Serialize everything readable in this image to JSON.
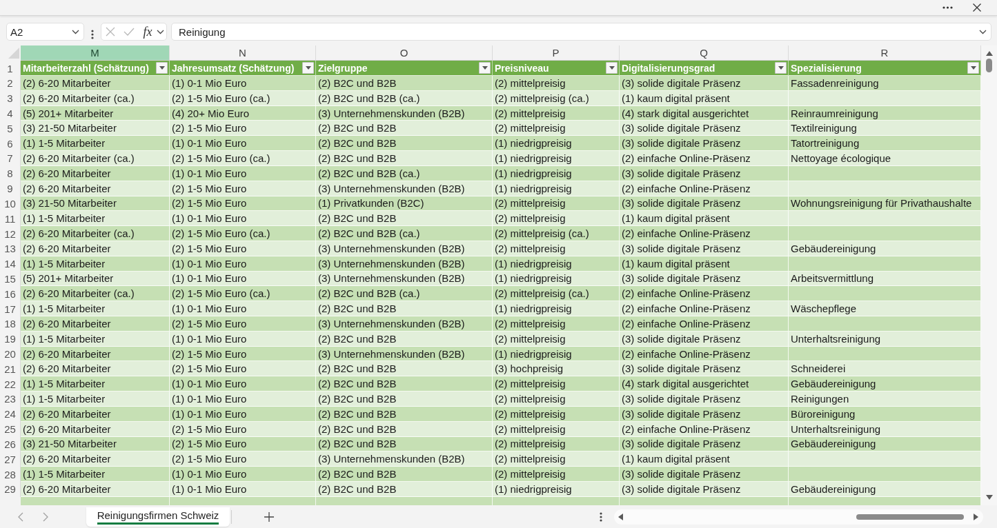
{
  "formula_bar": {
    "name_box": "A2",
    "function_button": "fx",
    "formula": "Reinigung"
  },
  "columns": [
    {
      "letter": "M",
      "selected": true
    },
    {
      "letter": "N",
      "selected": false
    },
    {
      "letter": "O",
      "selected": false
    },
    {
      "letter": "P",
      "selected": false
    },
    {
      "letter": "Q",
      "selected": false
    },
    {
      "letter": "R",
      "selected": false
    }
  ],
  "header_row": {
    "number": "1",
    "cells": [
      "Mitarbeiterzahl (Schätzung)",
      "Jahresumsatz (Schätzung)",
      "Zielgruppe",
      "Preisniveau",
      "Digitalisierungsgrad",
      "Spezialisierung"
    ]
  },
  "rows": [
    {
      "number": "2",
      "cells": [
        "(2) 6-20 Mitarbeiter",
        "(1) 0-1 Mio Euro",
        "(2) B2C und B2B",
        "(2) mittelpreisig",
        "(3) solide digitale Präsenz",
        "Fassadenreinigung"
      ]
    },
    {
      "number": "3",
      "cells": [
        "(2) 6-20 Mitarbeiter (ca.)",
        "(2) 1-5 Mio Euro (ca.)",
        "(2) B2C und B2B (ca.)",
        "(2) mittelpreisig (ca.)",
        "(1) kaum digital präsent"
      ]
    },
    {
      "number": "4",
      "cells": [
        "(5) 201+ Mitarbeiter",
        "(4) 20+ Mio Euro",
        "(3) Unternehmenskunden (B2B)",
        "(2) mittelpreisig",
        "(4) stark digital ausgerichtet",
        "Reinraumreinigung"
      ]
    },
    {
      "number": "5",
      "cells": [
        "(3) 21-50 Mitarbeiter",
        "(2) 1-5 Mio Euro",
        "(2) B2C und B2B",
        "(2) mittelpreisig",
        "(3) solide digitale Präsenz",
        "Textilreinigung"
      ]
    },
    {
      "number": "6",
      "cells": [
        "(1) 1-5 Mitarbeiter",
        "(1) 0-1 Mio Euro",
        "(2) B2C und B2B",
        "(1) niedrigpreisig",
        "(3) solide digitale Präsenz",
        "Tatortreinigung"
      ]
    },
    {
      "number": "7",
      "cells": [
        "(2) 6-20 Mitarbeiter (ca.)",
        "(2) 1-5 Mio Euro (ca.)",
        "(2) B2C und B2B",
        "(1) niedrigpreisig",
        "(2) einfache Online-Präsenz",
        "Nettoyage écologique"
      ]
    },
    {
      "number": "8",
      "cells": [
        "(2) 6-20 Mitarbeiter",
        "(1) 0-1 Mio Euro",
        "(2) B2C und B2B (ca.)",
        "(1) niedrigpreisig",
        "(3) solide digitale Präsenz"
      ]
    },
    {
      "number": "9",
      "cells": [
        "(2) 6-20 Mitarbeiter",
        "(2) 1-5 Mio Euro",
        "(3) Unternehmenskunden (B2B)",
        "(1) niedrigpreisig",
        "(2) einfache Online-Präsenz"
      ]
    },
    {
      "number": "10",
      "cells": [
        "(3) 21-50 Mitarbeiter",
        "(2) 1-5 Mio Euro",
        "(1) Privatkunden (B2C)",
        "(2) mittelpreisig",
        "(3) solide digitale Präsenz",
        "Wohnungsreinigung für Privathaushalte"
      ]
    },
    {
      "number": "11",
      "cells": [
        "(1) 1-5 Mitarbeiter",
        "(1) 0-1 Mio Euro",
        "(2) B2C und B2B",
        "(2) mittelpreisig",
        "(1) kaum digital präsent"
      ]
    },
    {
      "number": "12",
      "cells": [
        "(2) 6-20 Mitarbeiter (ca.)",
        "(2) 1-5 Mio Euro (ca.)",
        "(2) B2C und B2B (ca.)",
        "(2) mittelpreisig (ca.)",
        "(2) einfache Online-Präsenz"
      ]
    },
    {
      "number": "13",
      "cells": [
        "(2) 6-20 Mitarbeiter",
        "(2) 1-5 Mio Euro",
        "(3) Unternehmenskunden (B2B)",
        "(2) mittelpreisig",
        "(3) solide digitale Präsenz",
        "Gebäudereinigung"
      ]
    },
    {
      "number": "14",
      "cells": [
        "(1) 1-5 Mitarbeiter",
        "(1) 0-1 Mio Euro",
        "(3) Unternehmenskunden (B2B)",
        "(1) niedrigpreisig",
        "(1) kaum digital präsent"
      ]
    },
    {
      "number": "15",
      "cells": [
        "(5) 201+ Mitarbeiter",
        "(1) 0-1 Mio Euro",
        "(3) Unternehmenskunden (B2B)",
        "(1) niedrigpreisig",
        "(3) solide digitale Präsenz",
        "Arbeitsvermittlung"
      ]
    },
    {
      "number": "16",
      "cells": [
        "(2) 6-20 Mitarbeiter (ca.)",
        "(2) 1-5 Mio Euro (ca.)",
        "(2) B2C und B2B (ca.)",
        "(2) mittelpreisig (ca.)",
        "(2) einfache Online-Präsenz"
      ]
    },
    {
      "number": "17",
      "cells": [
        "(1) 1-5 Mitarbeiter",
        "(1) 0-1 Mio Euro",
        "(2) B2C und B2B",
        "(1) niedrigpreisig",
        "(2) einfache Online-Präsenz",
        "Wäschepflege"
      ]
    },
    {
      "number": "18",
      "cells": [
        "(2) 6-20 Mitarbeiter",
        "(2) 1-5 Mio Euro",
        "(3) Unternehmenskunden (B2B)",
        "(2) mittelpreisig",
        "(2) einfache Online-Präsenz"
      ]
    },
    {
      "number": "19",
      "cells": [
        "(1) 1-5 Mitarbeiter",
        "(1) 0-1 Mio Euro",
        "(2) B2C und B2B",
        "(2) mittelpreisig",
        "(3) solide digitale Präsenz",
        "Unterhaltsreinigung"
      ]
    },
    {
      "number": "20",
      "cells": [
        "(2) 6-20 Mitarbeiter",
        "(2) 1-5 Mio Euro",
        "(3) Unternehmenskunden (B2B)",
        "(1) niedrigpreisig",
        "(2) einfache Online-Präsenz"
      ]
    },
    {
      "number": "21",
      "cells": [
        "(2) 6-20 Mitarbeiter",
        "(2) 1-5 Mio Euro",
        "(2) B2C und B2B",
        "(3) hochpreisig",
        "(3) solide digitale Präsenz",
        "Schneiderei"
      ]
    },
    {
      "number": "22",
      "cells": [
        "(1) 1-5 Mitarbeiter",
        "(1) 0-1 Mio Euro",
        "(2) B2C und B2B",
        "(2) mittelpreisig",
        "(4) stark digital ausgerichtet",
        "Gebäudereinigung"
      ]
    },
    {
      "number": "23",
      "cells": [
        "(1) 1-5 Mitarbeiter",
        "(1) 0-1 Mio Euro",
        "(2) B2C und B2B",
        "(2) mittelpreisig",
        "(3) solide digitale Präsenz",
        "Reinigungen"
      ]
    },
    {
      "number": "24",
      "cells": [
        "(2) 6-20 Mitarbeiter",
        "(1) 0-1 Mio Euro",
        "(2) B2C und B2B",
        "(2) mittelpreisig",
        "(3) solide digitale Präsenz",
        "Büroreinigung"
      ]
    },
    {
      "number": "25",
      "cells": [
        "(2) 6-20 Mitarbeiter",
        "(2) 1-5 Mio Euro",
        "(2) B2C und B2B",
        "(2) mittelpreisig",
        "(2) einfache Online-Präsenz",
        "Unterhaltsreinigung"
      ]
    },
    {
      "number": "26",
      "cells": [
        "(3) 21-50 Mitarbeiter",
        "(2) 1-5 Mio Euro",
        "(2) B2C und B2B",
        "(2) mittelpreisig",
        "(3) solide digitale Präsenz",
        "Gebäudereinigung"
      ]
    },
    {
      "number": "27",
      "cells": [
        "(2) 6-20 Mitarbeiter",
        "(2) 1-5 Mio Euro",
        "(3) Unternehmenskunden (B2B)",
        "(2) mittelpreisig",
        "(1) kaum digital präsent"
      ]
    },
    {
      "number": "28",
      "cells": [
        "(1) 1-5 Mitarbeiter",
        "(1) 0-1 Mio Euro",
        "(2) B2C und B2B",
        "(2) mittelpreisig",
        "(3) solide digitale Präsenz"
      ]
    },
    {
      "number": "29",
      "cells": [
        "(2) 6-20 Mitarbeiter",
        "(1) 0-1 Mio Euro",
        "(2) B2C und B2B",
        "(1) niedrigpreisig",
        "(3) solide digitale Präsenz",
        "Gebäudereinigung"
      ]
    }
  ],
  "sheet_tabs": [
    {
      "label": "Reinigungsfirmen Schweiz",
      "selected": true
    }
  ]
}
